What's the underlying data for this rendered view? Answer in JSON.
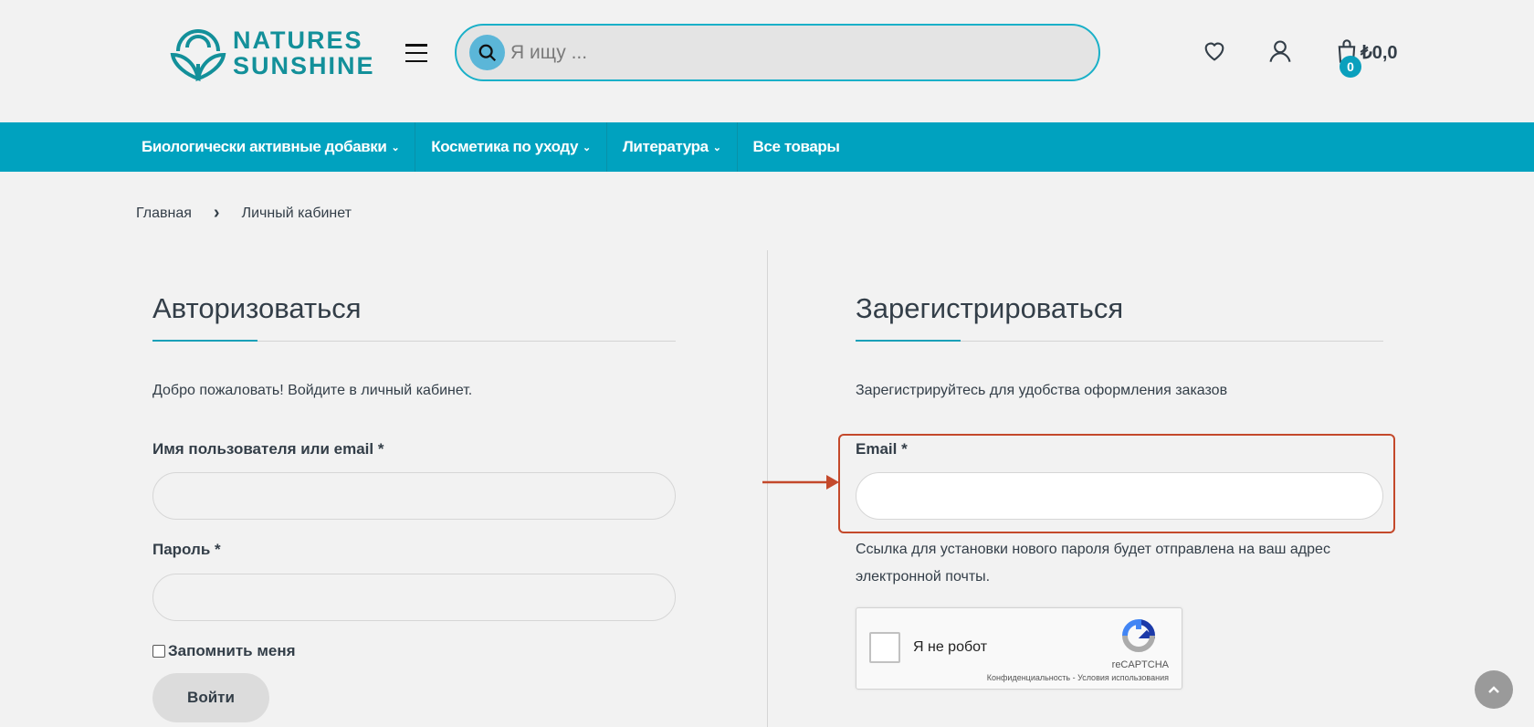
{
  "header": {
    "logo_line1": "NATURES",
    "logo_line2": "SUNSHINE",
    "search_placeholder": "Я ищу ...",
    "cart_count": "0",
    "cart_total": "₺0,0"
  },
  "nav": {
    "items": [
      {
        "label": "Биологически активные добавки",
        "dropdown": true
      },
      {
        "label": "Косметика по уходу",
        "dropdown": true
      },
      {
        "label": "Литература",
        "dropdown": true
      },
      {
        "label": "Все товары",
        "dropdown": false
      }
    ],
    "chevron": "⌄"
  },
  "breadcrumb": {
    "home": "Главная",
    "separator": "›",
    "current": "Личный кабинет"
  },
  "login": {
    "title": "Авторизоваться",
    "intro": "Добро пожаловать! Войдите в личный кабинет.",
    "username_label": "Имя пользователя или email *",
    "password_label": "Пароль *",
    "remember_label": "Запомнить меня",
    "submit": "Войти"
  },
  "register": {
    "title": "Зарегистрироваться",
    "intro": "Зарегистрируйтесь для удобства оформления заказов",
    "email_label": "Email *",
    "note_line1": "Ссылка для установки нового пароля будет отправлена на ваш адрес",
    "note_line2": "электронной почты."
  },
  "recaptcha": {
    "label": "Я не робот",
    "brand": "reCAPTCHA",
    "privacy": "Конфиденциальность",
    "separator": " - ",
    "terms": "Условия использования"
  },
  "colors": {
    "brand": "#00a2bf",
    "highlight": "#c4492b"
  }
}
